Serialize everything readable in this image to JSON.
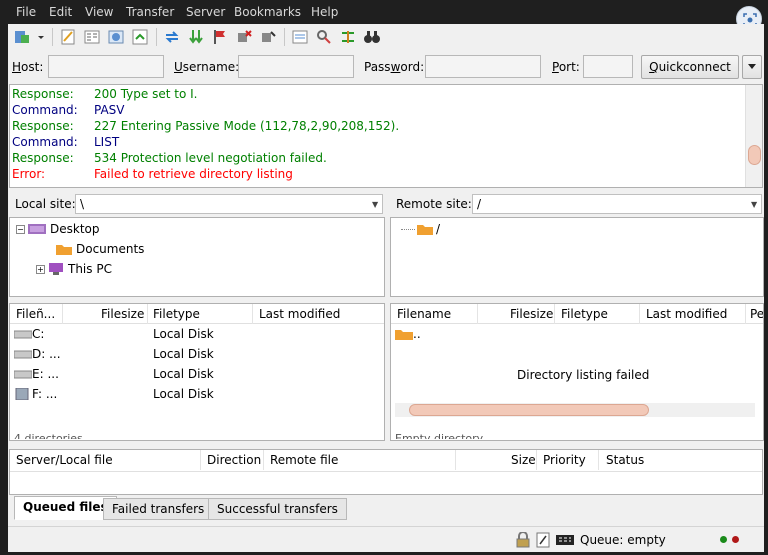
{
  "menu": [
    "File",
    "Edit",
    "View",
    "Transfer",
    "Server",
    "Bookmarks",
    "Help"
  ],
  "quickconnect": {
    "host_label": "Host:",
    "username_label": "Username:",
    "password_label": "Password:",
    "port_label": "Port:",
    "host_value": "",
    "username_value": "",
    "password_value": "",
    "port_value": "",
    "button_label": "Quickconnect"
  },
  "log": [
    {
      "type": "Response:",
      "msg": "200 Type set to I.",
      "kind": "resp"
    },
    {
      "type": "Command:",
      "msg": "PASV",
      "kind": "cmd"
    },
    {
      "type": "Response:",
      "msg": "227 Entering Passive Mode (112,78,2,90,208,152).",
      "kind": "resp"
    },
    {
      "type": "Command:",
      "msg": "LIST",
      "kind": "cmd"
    },
    {
      "type": "Response:",
      "msg": "534 Protection level negotiation failed.",
      "kind": "resp"
    },
    {
      "type": "Error:",
      "msg": "Failed to retrieve directory listing",
      "kind": "err"
    }
  ],
  "local": {
    "site_label": "Local site:",
    "site_path": "\\",
    "tree": [
      {
        "label": "Desktop"
      },
      {
        "label": "Documents"
      },
      {
        "label": "This PC"
      }
    ],
    "columns": [
      "Fileñ...",
      "Filesize",
      "Filetype",
      "Last modified"
    ],
    "rows": [
      {
        "name": "C:",
        "type": "Local Disk",
        "icon": "drive-icon"
      },
      {
        "name": "D: ...",
        "type": "Local Disk",
        "icon": "drive-icon"
      },
      {
        "name": "E: ...",
        "type": "Local Disk",
        "icon": "drive-icon"
      },
      {
        "name": "F: ...",
        "type": "Local Disk",
        "icon": "removable-drive-icon"
      }
    ],
    "status": "4 directories"
  },
  "remote": {
    "site_label": "Remote site:",
    "site_path": "/",
    "tree_root": "/",
    "columns": [
      "Filename",
      "Filesize",
      "Filetype",
      "Last modified",
      "Pe"
    ],
    "rows": [
      {
        "name": ".."
      }
    ],
    "message": "Directory listing failed",
    "status": "Empty directory."
  },
  "queue": {
    "columns": [
      "Server/Local file",
      "Direction",
      "Remote file",
      "Size",
      "Priority",
      "Status"
    ]
  },
  "tabs": [
    "Queued files",
    "Failed transfers",
    "Successful transfers"
  ],
  "statusbar": {
    "queue": "Queue: empty"
  },
  "colors": {
    "response": "#008000",
    "command": "#000080",
    "error": "#ff0000",
    "folder": "#f0a030",
    "scroll_thumb": "#f2c9b8"
  }
}
